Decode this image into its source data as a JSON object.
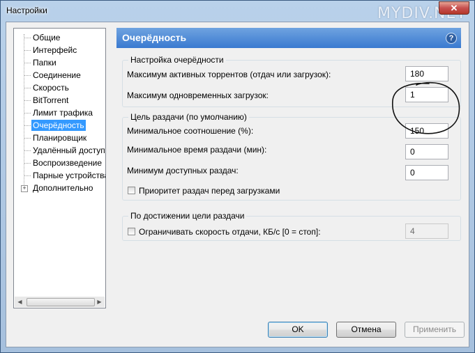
{
  "window": {
    "title": "Настройки",
    "watermark": "MYDIV.NET",
    "close_glyph": "✕"
  },
  "sidebar": {
    "items": [
      {
        "label": "Общие"
      },
      {
        "label": "Интерфейс"
      },
      {
        "label": "Папки"
      },
      {
        "label": "Соединение"
      },
      {
        "label": "Скорость"
      },
      {
        "label": "BitTorrent"
      },
      {
        "label": "Лимит трафика"
      },
      {
        "label": "Очерёдность",
        "selected": true
      },
      {
        "label": "Планировщик"
      },
      {
        "label": "Удалённый доступ"
      },
      {
        "label": "Воспроизведение"
      },
      {
        "label": "Парные устройства"
      },
      {
        "label": "Дополнительно",
        "expander": "+"
      }
    ]
  },
  "panel": {
    "title": "Очерёдность",
    "help_glyph": "?"
  },
  "queue_group": {
    "legend": "Настройка очерёдности",
    "max_active_label": "Максимум активных торрентов (отдач или загрузок):",
    "max_active_value": "180",
    "max_downloads_label": "Максимум одновременных загрузок:",
    "max_downloads_value": "1"
  },
  "seed_group": {
    "legend": "Цель раздачи (по умолчанию)",
    "min_ratio_label": "Минимальное соотношение (%):",
    "min_ratio_value": "150",
    "min_time_label": "Минимальное время раздачи (мин):",
    "min_time_value": "0",
    "min_available_label": "Минимум доступных раздач:",
    "min_available_value": "0",
    "priority_label": "Приоритет раздач перед загрузками",
    "priority_checked": false
  },
  "goal_group": {
    "legend": "По достижении цели раздачи",
    "limit_label": "Ограничивать скорость отдачи, КБ/с [0 = стоп]:",
    "limit_checked": false,
    "limit_value": "4"
  },
  "buttons": {
    "ok": "OK",
    "cancel": "Отмена",
    "apply": "Применить"
  },
  "colors": {
    "header": "#3a7ad0",
    "selection": "#3399ff"
  }
}
